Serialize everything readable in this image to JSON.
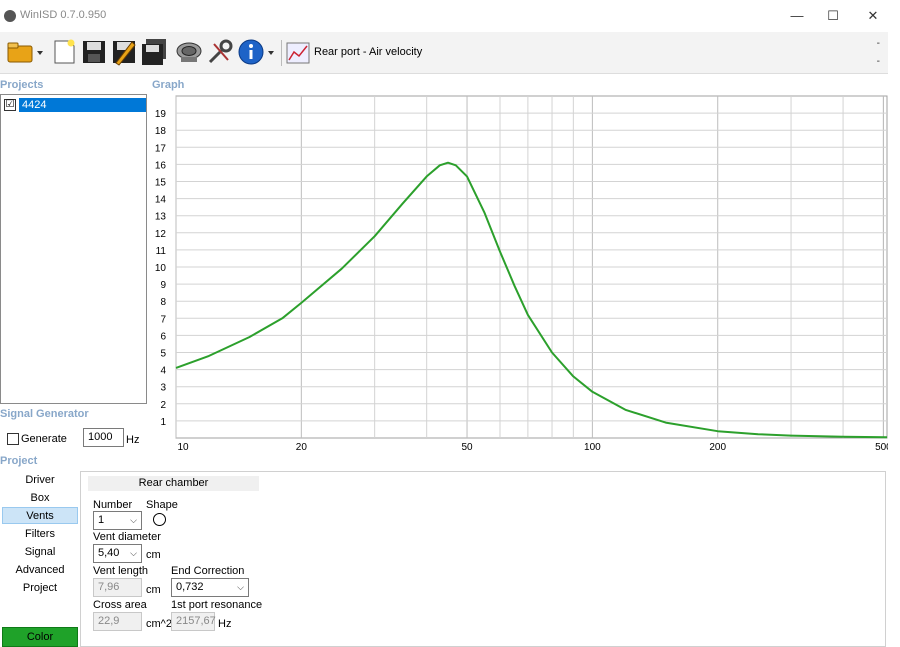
{
  "window": {
    "title": "WinISD 0.7.0.950",
    "minimize": "—",
    "maximize": "☐",
    "close": "✕"
  },
  "toolbar": {
    "graph_selector_label": "Rear port - Air velocity",
    "dash_top": "-",
    "dash_bottom": "-",
    "icons": [
      "open-folder-icon",
      "dropdown-arrow-icon",
      "new-file-icon",
      "save-icon",
      "save-as-icon",
      "save-all-icon",
      "driver-icon",
      "tools-icon",
      "info-icon",
      "dropdown-arrow-icon",
      "graph-icon"
    ]
  },
  "projects": {
    "label": "Projects",
    "items": [
      {
        "name": "4424",
        "checked": "☑"
      }
    ]
  },
  "graph": {
    "label": "Graph",
    "line_color": "#2ca02c"
  },
  "chart_data": {
    "type": "line",
    "title": "",
    "xlabel": "",
    "ylabel": "",
    "x_scale": "log",
    "xlim": [
      10,
      510
    ],
    "ylim": [
      0,
      20
    ],
    "x_tick_labels": [
      "10",
      "20",
      "50",
      "100",
      "200",
      "500"
    ],
    "x_ticks": [
      10,
      20,
      50,
      100,
      200,
      500
    ],
    "y_tick_labels": [
      "1",
      "2",
      "3",
      "4",
      "5",
      "6",
      "7",
      "8",
      "9",
      "10",
      "11",
      "12",
      "13",
      "14",
      "15",
      "16",
      "17",
      "18",
      "19"
    ],
    "y_ticks": [
      1,
      2,
      3,
      4,
      5,
      6,
      7,
      8,
      9,
      10,
      11,
      12,
      13,
      14,
      15,
      16,
      17,
      18,
      19
    ],
    "grid": true,
    "series": [
      {
        "x": [
          10,
          12,
          15,
          18,
          20,
          25,
          30,
          35,
          40,
          43,
          45,
          47,
          50,
          55,
          60,
          65,
          70,
          80,
          90,
          100,
          120,
          150,
          200,
          250,
          300,
          400,
          510
        ],
        "y": [
          4.1,
          4.8,
          5.9,
          7.0,
          7.9,
          9.9,
          11.8,
          13.7,
          15.3,
          15.95,
          16.1,
          15.95,
          15.3,
          13.2,
          10.9,
          8.9,
          7.2,
          5.0,
          3.6,
          2.7,
          1.65,
          0.9,
          0.4,
          0.22,
          0.14,
          0.07,
          0.04
        ]
      }
    ]
  },
  "signal_generator": {
    "label": "Signal Generator",
    "generate_label": "Generate",
    "frequency_value": "1000",
    "unit": "Hz"
  },
  "project_section": {
    "label": "Project",
    "nav": [
      "Driver",
      "Box",
      "Vents",
      "Filters",
      "Signal",
      "Advanced",
      "Project"
    ],
    "active": "Vents",
    "color_button": "Color"
  },
  "vents": {
    "chamber": "Rear chamber",
    "number_label": "Number",
    "number_value": "1",
    "shape_label": "Shape",
    "vent_diameter_label": "Vent diameter",
    "vent_diameter_value": "5,40",
    "vent_diameter_unit": "cm",
    "vent_length_label": "Vent length",
    "vent_length_value": "7,96",
    "vent_length_unit": "cm",
    "end_correction_label": "End Correction",
    "end_correction_value": "0,732",
    "cross_area_label": "Cross area",
    "cross_area_value": "22,9",
    "cross_area_unit": "cm^2",
    "port_resonance_label": "1st port resonance",
    "port_resonance_value": "2157,67",
    "port_resonance_unit": "Hz"
  }
}
